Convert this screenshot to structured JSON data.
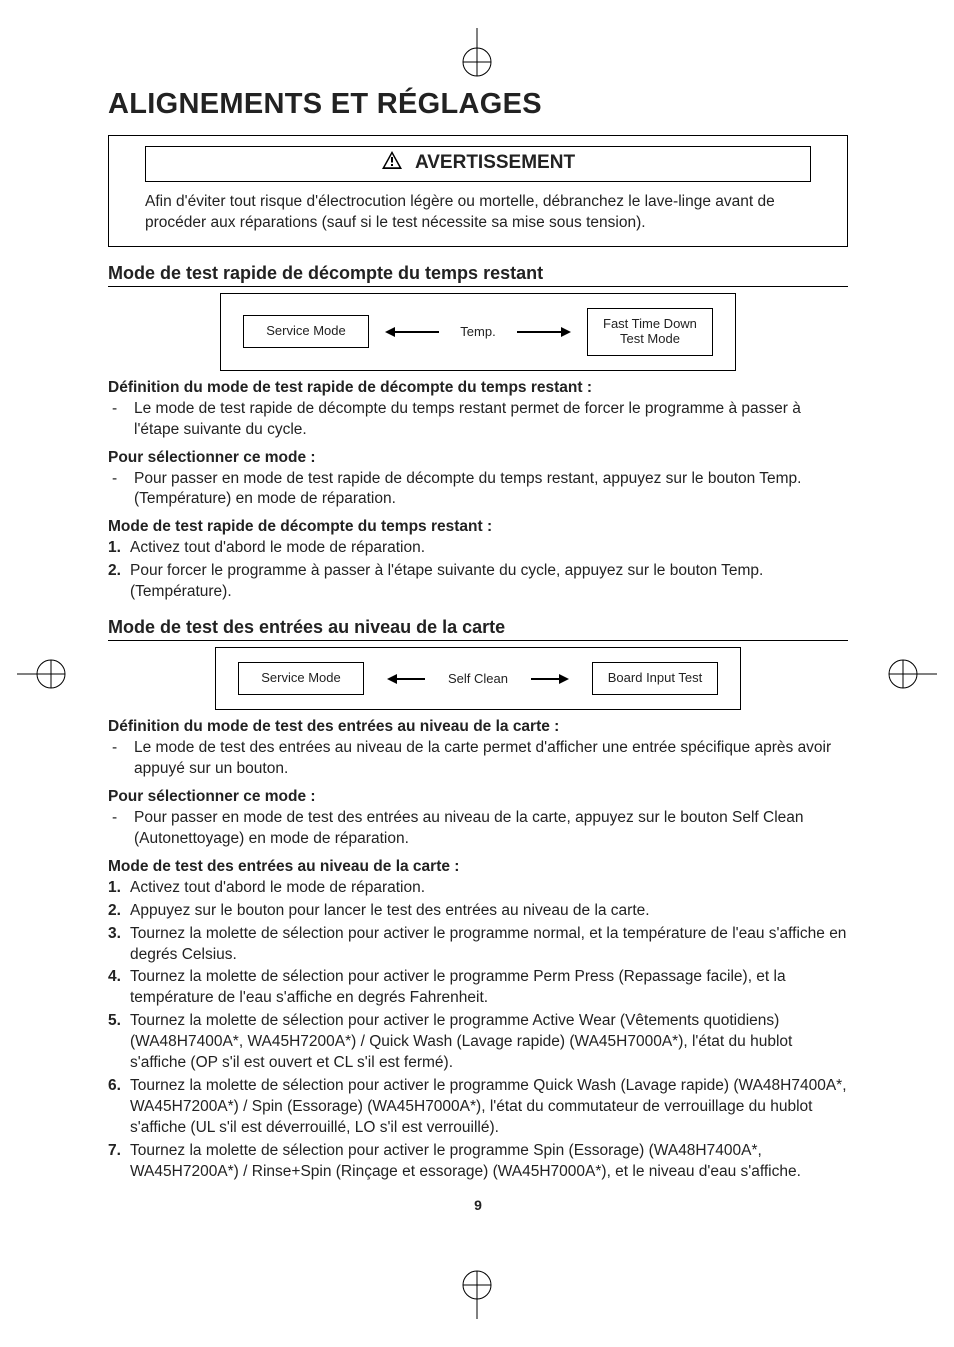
{
  "page_number": "9",
  "title": "ALIGNEMENTS ET RÉGLAGES",
  "warning": {
    "heading": "AVERTISSEMENT",
    "body": "Afin d'éviter tout risque d'électrocution légère ou mortelle, débranchez le lave-linge avant de procéder aux réparations (sauf si le test nécessite sa mise sous tension)."
  },
  "section_a": {
    "heading": "Mode de test rapide de décompte du temps restant",
    "diagram": {
      "left_box": "Service Mode",
      "mid_label": "Temp.",
      "right_box": "Fast Time Down\nTest Mode"
    },
    "def_head": "Définition du mode de test rapide de décompte du temps restant :",
    "def_item": "Le mode de test rapide de décompte du temps restant permet de forcer le programme à passer à l'étape suivante du cycle.",
    "sel_head": "Pour sélectionner ce mode :",
    "sel_item": "Pour passer en mode de test rapide de décompte du temps restant, appuyez sur le bouton Temp. (Température) en mode de réparation.",
    "steps_head": "Mode de test rapide de décompte du temps restant :",
    "steps": [
      "Activez tout d'abord le mode de réparation.",
      "Pour forcer le programme à passer à l'étape suivante du cycle, appuyez sur le bouton Temp. (Température)."
    ]
  },
  "section_b": {
    "heading": "Mode de test des entrées au niveau de la carte",
    "diagram": {
      "left_box": "Service Mode",
      "mid_label": "Self Clean",
      "right_box": "Board Input Test"
    },
    "def_head": "Définition du mode de test des entrées au niveau de la carte :",
    "def_item": "Le mode de test des entrées au niveau de la carte permet d'afficher une entrée spécifique après avoir appuyé sur un bouton.",
    "sel_head": "Pour sélectionner ce mode :",
    "sel_item": "Pour passer en mode de test des entrées au niveau de la carte, appuyez sur le bouton Self Clean (Autonettoyage) en mode de réparation.",
    "steps_head": "Mode de test des entrées au niveau de la carte :",
    "steps": [
      "Activez tout d'abord le mode de réparation.",
      "Appuyez sur le bouton pour lancer le test des entrées au niveau de la carte.",
      "Tournez la molette de sélection pour activer le programme normal, et la température de l'eau s'affiche en degrés Celsius.",
      "Tournez la molette de sélection pour activer le programme Perm Press (Repassage facile), et la température de l'eau s'affiche en degrés Fahrenheit.",
      "Tournez la molette de sélection pour activer le programme Active Wear (Vêtements quotidiens) (WA48H7400A*, WA45H7200A*) / Quick Wash (Lavage rapide) (WA45H7000A*), l'état du hublot s'affiche (OP s'il est ouvert et CL s'il est fermé).",
      "Tournez la molette de sélection pour activer le programme Quick Wash (Lavage rapide) (WA48H7400A*, WA45H7200A*) / Spin (Essorage) (WA45H7000A*), l'état du commutateur de verrouillage du hublot s'affiche (UL s'il est déverrouillé, LO s'il est verrouillé).",
      "Tournez la molette de sélection pour activer le programme Spin (Essorage) (WA48H7400A*, WA45H7200A*) / Rinse+Spin (Rinçage et essorage) (WA45H7000A*), et le niveau d'eau s'affiche."
    ]
  }
}
